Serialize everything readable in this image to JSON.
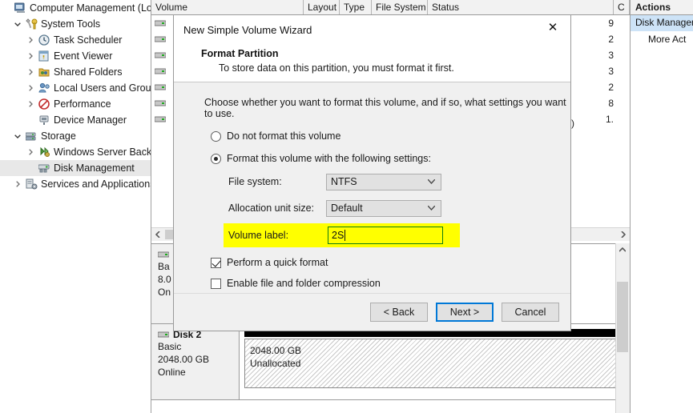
{
  "tree": {
    "items": [
      {
        "label": "Computer Management (Local",
        "depth": 0,
        "twisty": "",
        "icon": "computer-icon",
        "selected": false
      },
      {
        "label": "System Tools",
        "depth": 1,
        "twisty": "expanded",
        "icon": "tools-icon",
        "selected": false
      },
      {
        "label": "Task Scheduler",
        "depth": 2,
        "twisty": "collapsed",
        "icon": "clock-icon",
        "selected": false
      },
      {
        "label": "Event Viewer",
        "depth": 2,
        "twisty": "collapsed",
        "icon": "event-icon",
        "selected": false
      },
      {
        "label": "Shared Folders",
        "depth": 2,
        "twisty": "collapsed",
        "icon": "folder-icon",
        "selected": false
      },
      {
        "label": "Local Users and Groups",
        "depth": 2,
        "twisty": "collapsed",
        "icon": "users-icon",
        "selected": false
      },
      {
        "label": "Performance",
        "depth": 2,
        "twisty": "collapsed",
        "icon": "performance-icon",
        "selected": false
      },
      {
        "label": "Device Manager",
        "depth": 2,
        "twisty": "",
        "icon": "device-icon",
        "selected": false
      },
      {
        "label": "Storage",
        "depth": 1,
        "twisty": "expanded",
        "icon": "storage-icon",
        "selected": false
      },
      {
        "label": "Windows Server Backup",
        "depth": 2,
        "twisty": "collapsed",
        "icon": "backup-icon",
        "selected": false
      },
      {
        "label": "Disk Management",
        "depth": 2,
        "twisty": "",
        "icon": "disk-icon",
        "selected": true
      },
      {
        "label": "Services and Applications",
        "depth": 1,
        "twisty": "collapsed",
        "icon": "services-icon",
        "selected": false
      }
    ]
  },
  "volume_table": {
    "columns": [
      "Volume",
      "Layout",
      "Type",
      "File System",
      "Status",
      "C"
    ],
    "rows": [
      {
        "capacity": "9"
      },
      {
        "capacity": "2"
      },
      {
        "capacity": "3"
      },
      {
        "capacity": "3"
      },
      {
        "capacity": "2"
      },
      {
        "capacity": "8"
      },
      {
        "capacity": "1."
      }
    ],
    "partial_status_text": "Partition)"
  },
  "disks": [
    {
      "name": "",
      "type": "Ba",
      "capacity": "8.0",
      "state": "On",
      "partial": true
    },
    {
      "name": "Disk 2",
      "type": "Basic",
      "capacity": "2048.00 GB",
      "state": "Online",
      "partition_size": "2048.00 GB",
      "partition_status": "Unallocated",
      "partial": false
    }
  ],
  "actions": {
    "header": "Actions",
    "selected_item": "Disk Managem",
    "more_item": "More Act"
  },
  "dialog": {
    "title": "New Simple Volume Wizard",
    "close_glyph": "✕",
    "heading": "Format Partition",
    "subheading": "To store data on this partition, you must format it first.",
    "intro": "Choose whether you want to format this volume, and if so, what settings you want to use.",
    "radio_no_format": "Do not format this volume",
    "radio_format": "Format this volume with the following settings:",
    "label_file_system": "File system:",
    "value_file_system": "NTFS",
    "label_allocation": "Allocation unit size:",
    "value_allocation": "Default",
    "label_volume": "Volume label:",
    "value_volume": "2S",
    "check_quick_format": "Perform a quick format",
    "check_compression": "Enable file and folder compression",
    "btn_back": "< Back",
    "btn_next": "Next >",
    "btn_cancel": "Cancel",
    "chevron": "⌄",
    "highlight_color": "#FFFF00",
    "input_border_color": "#107C10",
    "focus_color": "#0078D7"
  }
}
